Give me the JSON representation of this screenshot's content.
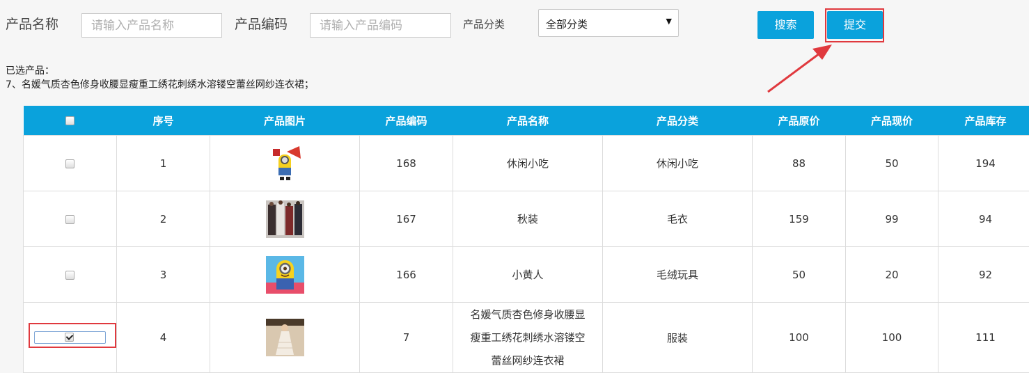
{
  "filters": {
    "name_label": "产品名称",
    "name_placeholder": "请输入产品名称",
    "code_label": "产品编码",
    "code_placeholder": "请输入产品编码",
    "category_label": "产品分类",
    "category_selected": "全部分类"
  },
  "buttons": {
    "search": "搜索",
    "submit": "提交"
  },
  "selected": {
    "label": "已选产品：",
    "items": "7、名媛气质杏色修身收腰显瘦重工绣花刺绣水溶镂空蕾丝网纱连衣裙；"
  },
  "table": {
    "headers": [
      "序号",
      "产品图片",
      "产品编码",
      "产品名称",
      "产品分类",
      "产品原价",
      "产品现价",
      "产品库存"
    ],
    "rows": [
      {
        "index": "1",
        "code": "168",
        "name": "休闲小吃",
        "category": "休闲小吃",
        "price_original": "88",
        "price_current": "50",
        "stock": "194",
        "checked": false,
        "image": "minion-megaphone-image"
      },
      {
        "index": "2",
        "code": "167",
        "name": "秋装",
        "category": "毛衣",
        "price_original": "159",
        "price_current": "99",
        "stock": "94",
        "checked": false,
        "image": "autumn-outfits-image"
      },
      {
        "index": "3",
        "code": "166",
        "name": "小黄人",
        "category": "毛绒玩具",
        "price_original": "50",
        "price_current": "20",
        "stock": "92",
        "checked": false,
        "image": "minion-toy-image"
      },
      {
        "index": "4",
        "code": "7",
        "name_lines": [
          "名媛气质杏色修身收腰显",
          "瘦重工绣花刺绣水溶镂空",
          "蕾丝网纱连衣裙"
        ],
        "category": "服装",
        "price_original": "100",
        "price_current": "100",
        "stock": "111",
        "checked": true,
        "image": "lace-dress-image"
      }
    ]
  },
  "colors": {
    "accent": "#0aa2dc",
    "highlight": "#e0393e"
  }
}
